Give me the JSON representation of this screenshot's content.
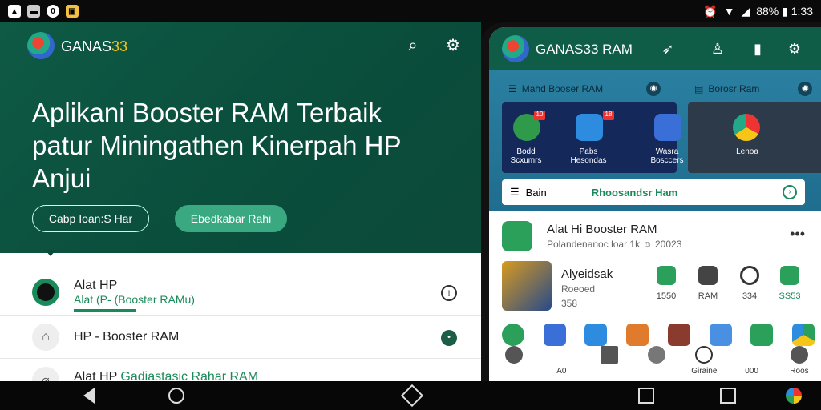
{
  "status_bar": {
    "right_text": "88% ▮ 1:33"
  },
  "left": {
    "brand_main": "GANAS",
    "brand_accent": "33",
    "hero_title": "Aplikani Booster RAM Terbaik patur Miningathen Kinerpah HP Anjui",
    "btn_outline": "Cabp Ioan:S Har",
    "btn_fill": "Ebedkabar Rahi",
    "rows": [
      {
        "title": "Alat HP",
        "sub": "Alat (P-  (Booster RAMu)"
      },
      {
        "title": "HP - Booster RAM"
      },
      {
        "title": "Alat HP",
        "sub": "Gadiastasic Rahar RAM"
      }
    ]
  },
  "phone": {
    "brand": "GANAS33 RAM",
    "tab1": "Mahd Booser RAM",
    "tab2": "Borosr Ram",
    "cardA": [
      "Bodd Scxumrs",
      "Pabs Hesondas",
      "Wasra Bosccers"
    ],
    "cardB": "Lenoa",
    "bar_left": "Bain",
    "bar_green": "Rhoosandsr Ham",
    "row1_title": "Alat Hi Booster RAM",
    "row1_sub": "Polandenanoc  loar  1k  ☺ 20023",
    "row2_title": "Alyeidsak",
    "row2_sub1": "Roeoed",
    "row2_sub2": "358",
    "mini": [
      "1550",
      "RAM",
      "334",
      "SS53"
    ],
    "dock": [
      "",
      "A0",
      "",
      "",
      "Giraine",
      "000",
      "Roos"
    ]
  },
  "colors": {
    "hero": "#0e5a45",
    "accent": "#3aa982",
    "green_text": "#1b8a5a"
  }
}
